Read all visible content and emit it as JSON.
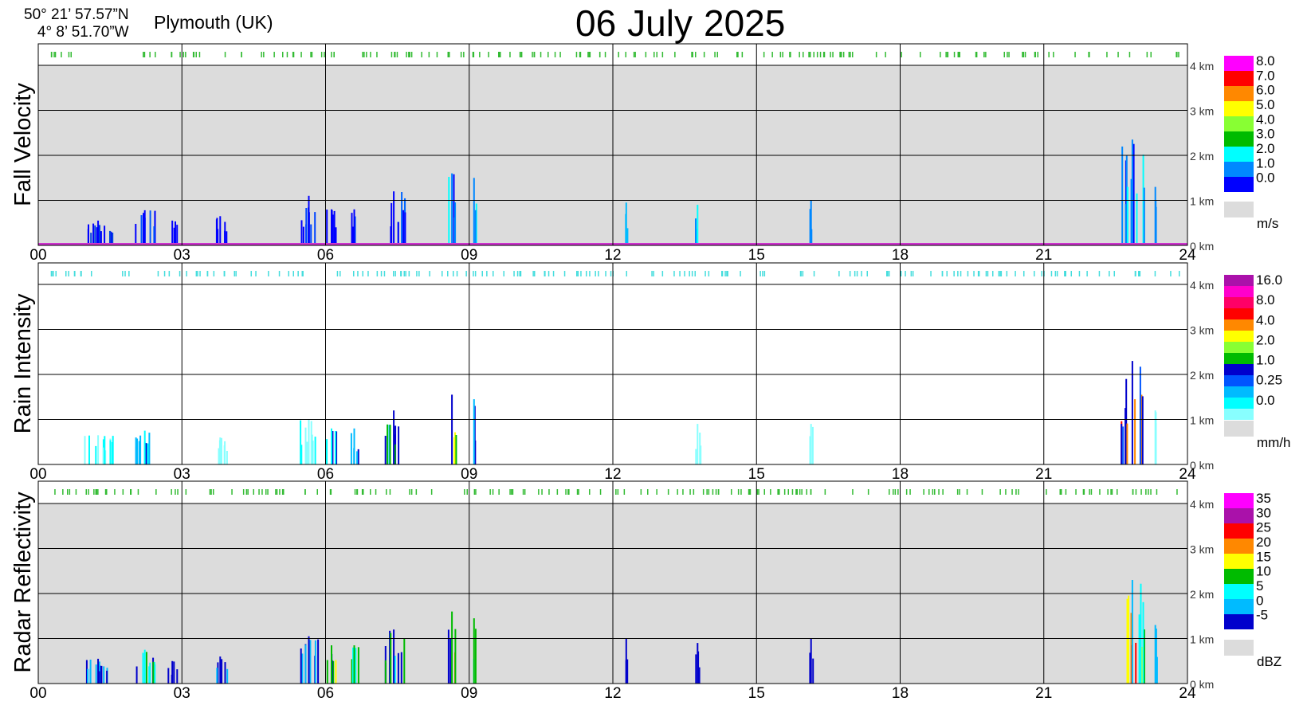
{
  "header": {
    "latitude": "50° 21’ 57.57”N",
    "longitude": "4°  8’ 51.70”W",
    "location": "Plymouth (UK)",
    "date_day": "06",
    "date_month": "July",
    "date_year": "2025"
  },
  "colors": {
    "panel_bg_gray": "#dcdcdc",
    "panel_bg_white": "#ffffff",
    "grid": "#000000",
    "top_marks_green": "#33bb33",
    "top_marks_cyan": "#44dddd",
    "ground_line": "#cc33cc"
  },
  "chart_data": [
    {
      "type": "heatmap",
      "title": "Fall Velocity",
      "unit": "m/s",
      "background": "gray",
      "x_ticks": [
        "00",
        "03",
        "06",
        "09",
        "12",
        "15",
        "18",
        "21",
        "24"
      ],
      "xlim": [
        0,
        24
      ],
      "y_ticks": [
        "0 km",
        "1 km",
        "2 km",
        "3 km",
        "4 km"
      ],
      "ylim_km": [
        0,
        4.5
      ],
      "colorbar": {
        "labels": [
          "8.0",
          "7.0",
          "6.0",
          "5.0",
          "4.0",
          "3.0",
          "2.0",
          "1.0",
          "0.0"
        ],
        "colors": [
          "#ff00ff",
          "#ff0000",
          "#ff8800",
          "#ffff00",
          "#88ff33",
          "#00bb00",
          "#00ffff",
          "#0088ff",
          "#0000ff"
        ]
      },
      "echoes": [
        {
          "t": 0.95,
          "w": 0.6,
          "top": 0.55,
          "colors": [
            "#0000ff",
            "#0044dd"
          ]
        },
        {
          "t": 2.0,
          "w": 0.45,
          "top": 0.78,
          "colors": [
            "#0000ff",
            "#0055ff"
          ]
        },
        {
          "t": 2.7,
          "w": 0.2,
          "top": 0.55,
          "colors": [
            "#0000ff"
          ]
        },
        {
          "t": 3.65,
          "w": 0.3,
          "top": 0.65,
          "colors": [
            "#0000ff"
          ]
        },
        {
          "t": 5.45,
          "w": 0.4,
          "top": 1.1,
          "colors": [
            "#0000ff",
            "#0044ff"
          ]
        },
        {
          "t": 6.0,
          "w": 0.25,
          "top": 0.8,
          "colors": [
            "#0000ff"
          ]
        },
        {
          "t": 6.5,
          "w": 0.2,
          "top": 0.8,
          "colors": [
            "#0000ff",
            "#0055ff"
          ]
        },
        {
          "t": 7.2,
          "w": 0.45,
          "top": 1.2,
          "colors": [
            "#0000ff",
            "#0066ff"
          ]
        },
        {
          "t": 8.55,
          "w": 0.18,
          "top": 1.6,
          "colors": [
            "#0088ff",
            "#00ffff",
            "#00bb00",
            "#0000ff"
          ]
        },
        {
          "t": 9.05,
          "w": 0.1,
          "top": 1.5,
          "colors": [
            "#0088ff",
            "#00ffff"
          ]
        },
        {
          "t": 12.25,
          "w": 0.06,
          "top": 0.95,
          "colors": [
            "#00bbff"
          ]
        },
        {
          "t": 13.7,
          "w": 0.14,
          "top": 0.9,
          "colors": [
            "#00ffff",
            "#0088ff"
          ]
        },
        {
          "t": 16.1,
          "w": 0.08,
          "top": 1.0,
          "colors": [
            "#0088ff"
          ]
        },
        {
          "t": 22.6,
          "w": 0.5,
          "top": 2.35,
          "colors": [
            "#0088ff",
            "#00ffff",
            "#00bb00",
            "#0000ff"
          ]
        },
        {
          "t": 23.3,
          "w": 0.06,
          "top": 1.3,
          "colors": [
            "#0088ff"
          ]
        }
      ]
    },
    {
      "type": "heatmap",
      "title": "Rain Intensity",
      "unit": "mm/h",
      "background": "white",
      "x_ticks": [
        "00",
        "03",
        "06",
        "09",
        "12",
        "15",
        "18",
        "21",
        "24"
      ],
      "xlim": [
        0,
        24
      ],
      "y_ticks": [
        "0 km",
        "1 km",
        "2 km",
        "3 km",
        "4 km"
      ],
      "ylim_km": [
        0,
        4.5
      ],
      "colorbar": {
        "labels": [
          "16.0",
          "8.0",
          "4.0",
          "2.0",
          "1.0",
          "0.25",
          "0.0"
        ],
        "colors": [
          "#aa11aa",
          "#ff00cc",
          "#ff0066",
          "#ff0000",
          "#ff8800",
          "#ffff00",
          "#88ff33",
          "#00bb00",
          "#0000cc",
          "#0055ff",
          "#00bbff",
          "#00ffff",
          "#88ffff"
        ]
      },
      "echoes": [
        {
          "t": 0.95,
          "w": 0.6,
          "top": 0.65,
          "colors": [
            "#88ffff",
            "#00ffff"
          ]
        },
        {
          "t": 2.0,
          "w": 0.45,
          "top": 0.75,
          "colors": [
            "#00ffff",
            "#0000cc",
            "#00bbff"
          ]
        },
        {
          "t": 3.65,
          "w": 0.3,
          "top": 0.6,
          "colors": [
            "#88ffff"
          ]
        },
        {
          "t": 5.45,
          "w": 0.4,
          "top": 1.0,
          "colors": [
            "#88ffff",
            "#00ffff"
          ]
        },
        {
          "t": 6.0,
          "w": 0.25,
          "top": 0.8,
          "colors": [
            "#00ffff",
            "#0000cc"
          ]
        },
        {
          "t": 6.5,
          "w": 0.2,
          "top": 0.8,
          "colors": [
            "#00bbff",
            "#0000cc"
          ]
        },
        {
          "t": 7.2,
          "w": 0.45,
          "top": 1.2,
          "colors": [
            "#0000cc",
            "#00bbff",
            "#00bb00"
          ]
        },
        {
          "t": 8.55,
          "w": 0.18,
          "top": 1.55,
          "colors": [
            "#0000cc",
            "#00bb00",
            "#ffff00",
            "#aa11aa"
          ]
        },
        {
          "t": 9.05,
          "w": 0.1,
          "top": 1.45,
          "colors": [
            "#00bbff",
            "#0000cc"
          ]
        },
        {
          "t": 13.7,
          "w": 0.14,
          "top": 0.9,
          "colors": [
            "#88ffff"
          ]
        },
        {
          "t": 16.1,
          "w": 0.08,
          "top": 0.9,
          "colors": [
            "#88ffff"
          ]
        },
        {
          "t": 22.6,
          "w": 0.5,
          "top": 2.3,
          "colors": [
            "#0000cc",
            "#0055ff",
            "#ff0000",
            "#ff8800",
            "#00bb00"
          ]
        },
        {
          "t": 23.3,
          "w": 0.06,
          "top": 1.2,
          "colors": [
            "#88ffff"
          ]
        }
      ]
    },
    {
      "type": "heatmap",
      "title": "Radar Reflectivity",
      "unit": "dBZ",
      "background": "gray",
      "x_ticks": [
        "00",
        "03",
        "06",
        "09",
        "12",
        "15",
        "18",
        "21",
        "24"
      ],
      "xlim": [
        0,
        24
      ],
      "y_ticks": [
        "0 km",
        "1 km",
        "2 km",
        "3 km",
        "4 km"
      ],
      "ylim_km": [
        0,
        4.5
      ],
      "colorbar": {
        "labels": [
          "35",
          "30",
          "25",
          "20",
          "15",
          "10",
          "5",
          "0",
          "-5"
        ],
        "colors": [
          "#ff00ff",
          "#aa11aa",
          "#ff0000",
          "#ff8800",
          "#ffff00",
          "#00bb00",
          "#00ffff",
          "#00bbff",
          "#0000cc"
        ]
      },
      "echoes": [
        {
          "t": 0.95,
          "w": 0.6,
          "top": 0.55,
          "colors": [
            "#0000cc",
            "#00bbff"
          ]
        },
        {
          "t": 2.0,
          "w": 0.45,
          "top": 0.75,
          "colors": [
            "#00ffff",
            "#00bb00",
            "#0000cc"
          ]
        },
        {
          "t": 2.7,
          "w": 0.2,
          "top": 0.5,
          "colors": [
            "#0000cc"
          ]
        },
        {
          "t": 3.65,
          "w": 0.3,
          "top": 0.6,
          "colors": [
            "#0000cc",
            "#00bbff"
          ]
        },
        {
          "t": 5.45,
          "w": 0.4,
          "top": 1.05,
          "colors": [
            "#0000cc",
            "#00bbff"
          ]
        },
        {
          "t": 6.0,
          "w": 0.25,
          "top": 0.85,
          "colors": [
            "#00bb00",
            "#ffff00",
            "#0000cc"
          ]
        },
        {
          "t": 6.5,
          "w": 0.2,
          "top": 0.85,
          "colors": [
            "#00bb00",
            "#00ffff"
          ]
        },
        {
          "t": 7.2,
          "w": 0.45,
          "top": 1.2,
          "colors": [
            "#0000cc",
            "#00bb00",
            "#00ffff"
          ]
        },
        {
          "t": 8.55,
          "w": 0.18,
          "top": 1.6,
          "colors": [
            "#00bb00",
            "#ffff00",
            "#ff8800",
            "#0000cc"
          ]
        },
        {
          "t": 9.05,
          "w": 0.1,
          "top": 1.45,
          "colors": [
            "#00bb00",
            "#00ffff"
          ]
        },
        {
          "t": 12.25,
          "w": 0.06,
          "top": 1.0,
          "colors": [
            "#0000cc"
          ]
        },
        {
          "t": 13.7,
          "w": 0.14,
          "top": 0.9,
          "colors": [
            "#0000cc"
          ]
        },
        {
          "t": 16.1,
          "w": 0.08,
          "top": 1.0,
          "colors": [
            "#0000cc"
          ]
        },
        {
          "t": 22.6,
          "w": 0.5,
          "top": 2.3,
          "colors": [
            "#00bbff",
            "#00ffff",
            "#00bb00",
            "#ffff00",
            "#ff8800",
            "#ff0000"
          ]
        },
        {
          "t": 23.3,
          "w": 0.06,
          "top": 1.3,
          "colors": [
            "#00bbff"
          ]
        }
      ]
    }
  ]
}
